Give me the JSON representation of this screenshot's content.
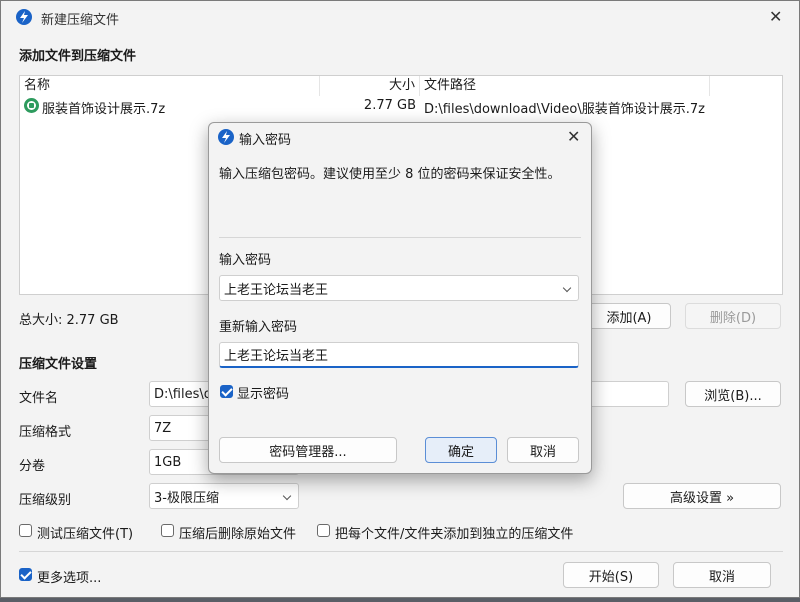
{
  "window": {
    "title": "新建压缩文件",
    "section_add": "添加文件到压缩文件",
    "columns": {
      "name": "名称",
      "size": "大小",
      "path": "文件路径"
    },
    "files": [
      {
        "name": "服装首饰设计展示.7z",
        "size": "2.77 GB",
        "path": "D:\\files\\download\\Video\\服装首饰设计展示.7z"
      }
    ],
    "total_size": "总大小: 2.77 GB",
    "add_button": "添加(A)",
    "delete_button": "删除(D)",
    "section_settings": "压缩文件设置",
    "filename_label": "文件名",
    "filename_value": "D:\\files\\d",
    "browse_button": "浏览(B)...",
    "format_label": "压缩格式",
    "format_value": "7Z",
    "volume_label": "分卷",
    "volume_value": "1GB",
    "level_label": "压缩级别",
    "level_value": "3-极限压缩",
    "advanced_button": "高级设置 »",
    "opt_test": "测试压缩文件(T)",
    "opt_delete": "压缩后删除原始文件",
    "opt_separate": "把每个文件/文件夹添加到独立的压缩文件",
    "more_options": "更多选项...",
    "start_button": "开始(S)",
    "cancel_button": "取消"
  },
  "dialog": {
    "title": "输入密码",
    "description": "输入压缩包密码。建议使用至少 8 位的密码来保证安全性。",
    "password_label": "输入密码",
    "password_value": "上老王论坛当老王",
    "reenter_label": "重新输入密码",
    "reenter_value": "上老王论坛当老王",
    "show_password": "显示密码",
    "manager_button": "密码管理器...",
    "ok_button": "确定",
    "cancel_button": "取消"
  },
  "state": {
    "show_password_checked": true,
    "more_options_checked": true,
    "test_checked": false,
    "delete_after_checked": false,
    "separate_checked": false
  },
  "colors": {
    "accent": "#1a63c7",
    "file_icon": "#2e9b5e"
  }
}
